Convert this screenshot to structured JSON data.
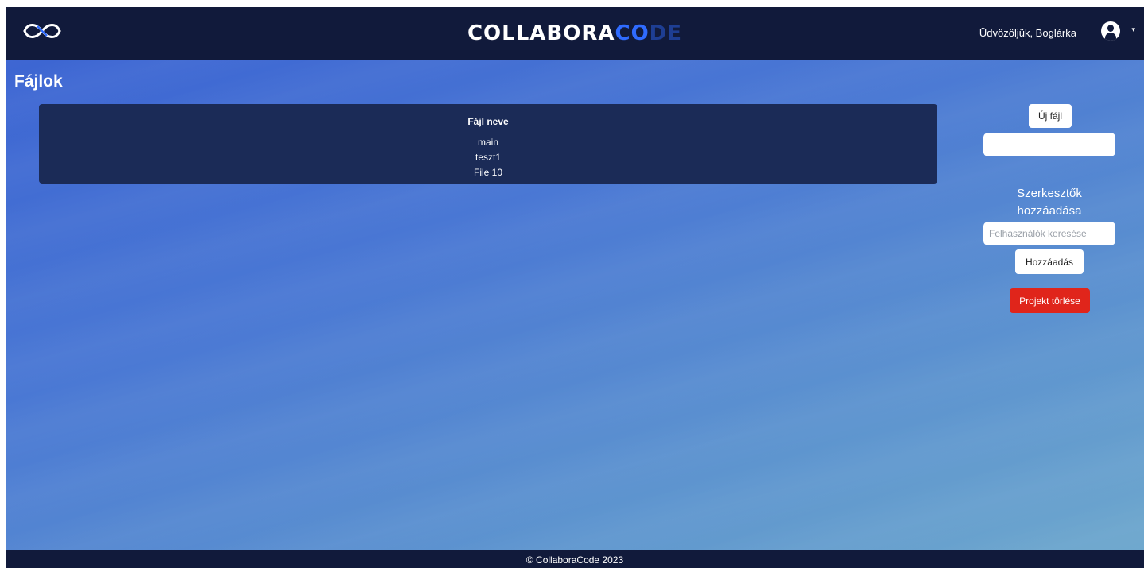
{
  "navbar": {
    "logo_icon": "infinity-logo-icon",
    "brand_part1": "COLLABORA",
    "brand_part2": "CO",
    "brand_part3": "DE",
    "welcome": "Üdvözöljük, Boglárka",
    "avatar_icon": "user-avatar-icon",
    "caret_icon": "chevron-down-icon",
    "caret_glyph": "▾"
  },
  "page": {
    "title": "Fájlok"
  },
  "files_table": {
    "header": "Fájl neve",
    "rows": [
      "main",
      "teszt1",
      "File 10"
    ]
  },
  "sidebar": {
    "new_file_label": "Új fájl",
    "new_file_name_value": "",
    "editors_title_line1": "Szerkesztők",
    "editors_title_line2": "hozzáadása",
    "user_search_placeholder": "Felhasználók keresése",
    "add_label": "Hozzáadás",
    "delete_project_label": "Projekt törlése"
  },
  "footer": {
    "text": "© CollaboraCode 2023"
  },
  "colors": {
    "navbar_bg": "#111a3b",
    "table_bg": "#1b2b57",
    "delete_button": "#e0251b",
    "brand_accent": "#2f6bff"
  }
}
